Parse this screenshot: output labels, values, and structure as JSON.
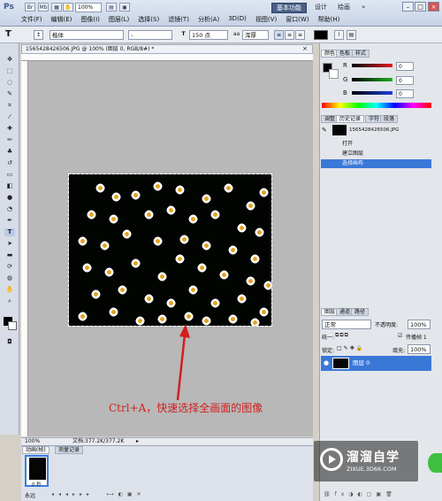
{
  "app": {
    "logo": "Ps"
  },
  "menubar": {
    "zoom": "100%",
    "workspaces": [
      "基本功能",
      "设计",
      "绘画"
    ],
    "more_label": "»",
    "menus": [
      "文件(F)",
      "编辑(E)",
      "图像(I)",
      "图层(L)",
      "选择(S)",
      "滤镜(T)",
      "分析(A)",
      "3D(D)",
      "视图(V)",
      "窗口(W)",
      "帮助(H)"
    ]
  },
  "options": {
    "tool_glyph": "T",
    "font_family": "楷体",
    "font_style": "-",
    "font_size": "150 点",
    "aa_label": "aa",
    "anti_alias": "浑厚"
  },
  "document": {
    "tab_title": "1565428426506.JPG @ 100% (图层 0, RGB/8#) *",
    "annotation": "Ctrl+A，快速选择全画面的图像",
    "status_zoom": "100%",
    "status_doc": "文档:377.2K/377.2K"
  },
  "animation": {
    "tabs": [
      "动画(帧)",
      "测量记录"
    ],
    "frame_time": "0 秒",
    "loop": "永远"
  },
  "color_panel": {
    "tabs": [
      "颜色",
      "色板",
      "样式"
    ],
    "channels": [
      {
        "label": "R",
        "value": "0",
        "color": "#e02020"
      },
      {
        "label": "G",
        "value": "0",
        "color": "#20b020"
      },
      {
        "label": "B",
        "value": "0",
        "color": "#2040e0"
      }
    ]
  },
  "history_panel": {
    "tabs": [
      "调整",
      "历史记录",
      "字符",
      "段落"
    ],
    "snapshot": "1565428426506.JPG",
    "items": [
      "打开",
      "建立图层",
      "选择画布"
    ]
  },
  "layers_panel": {
    "tabs": [
      "图层",
      "通道",
      "路径"
    ],
    "blend_mode": "正常",
    "opacity_label": "不透明度:",
    "opacity": "100%",
    "lock_label": "锁定:",
    "unify_label": "统一:",
    "propagate_label": "传播帧 1",
    "fill_label": "填充:",
    "fill": "100%",
    "layer_name": "图层 0"
  },
  "watermark": {
    "title": "溜溜自学",
    "url": "ZIXUE.3D66.COM"
  },
  "colors": {
    "accent": "#3a78d8",
    "annotation": "#d21e1e",
    "canvas_bg": "#b8b8b8"
  }
}
